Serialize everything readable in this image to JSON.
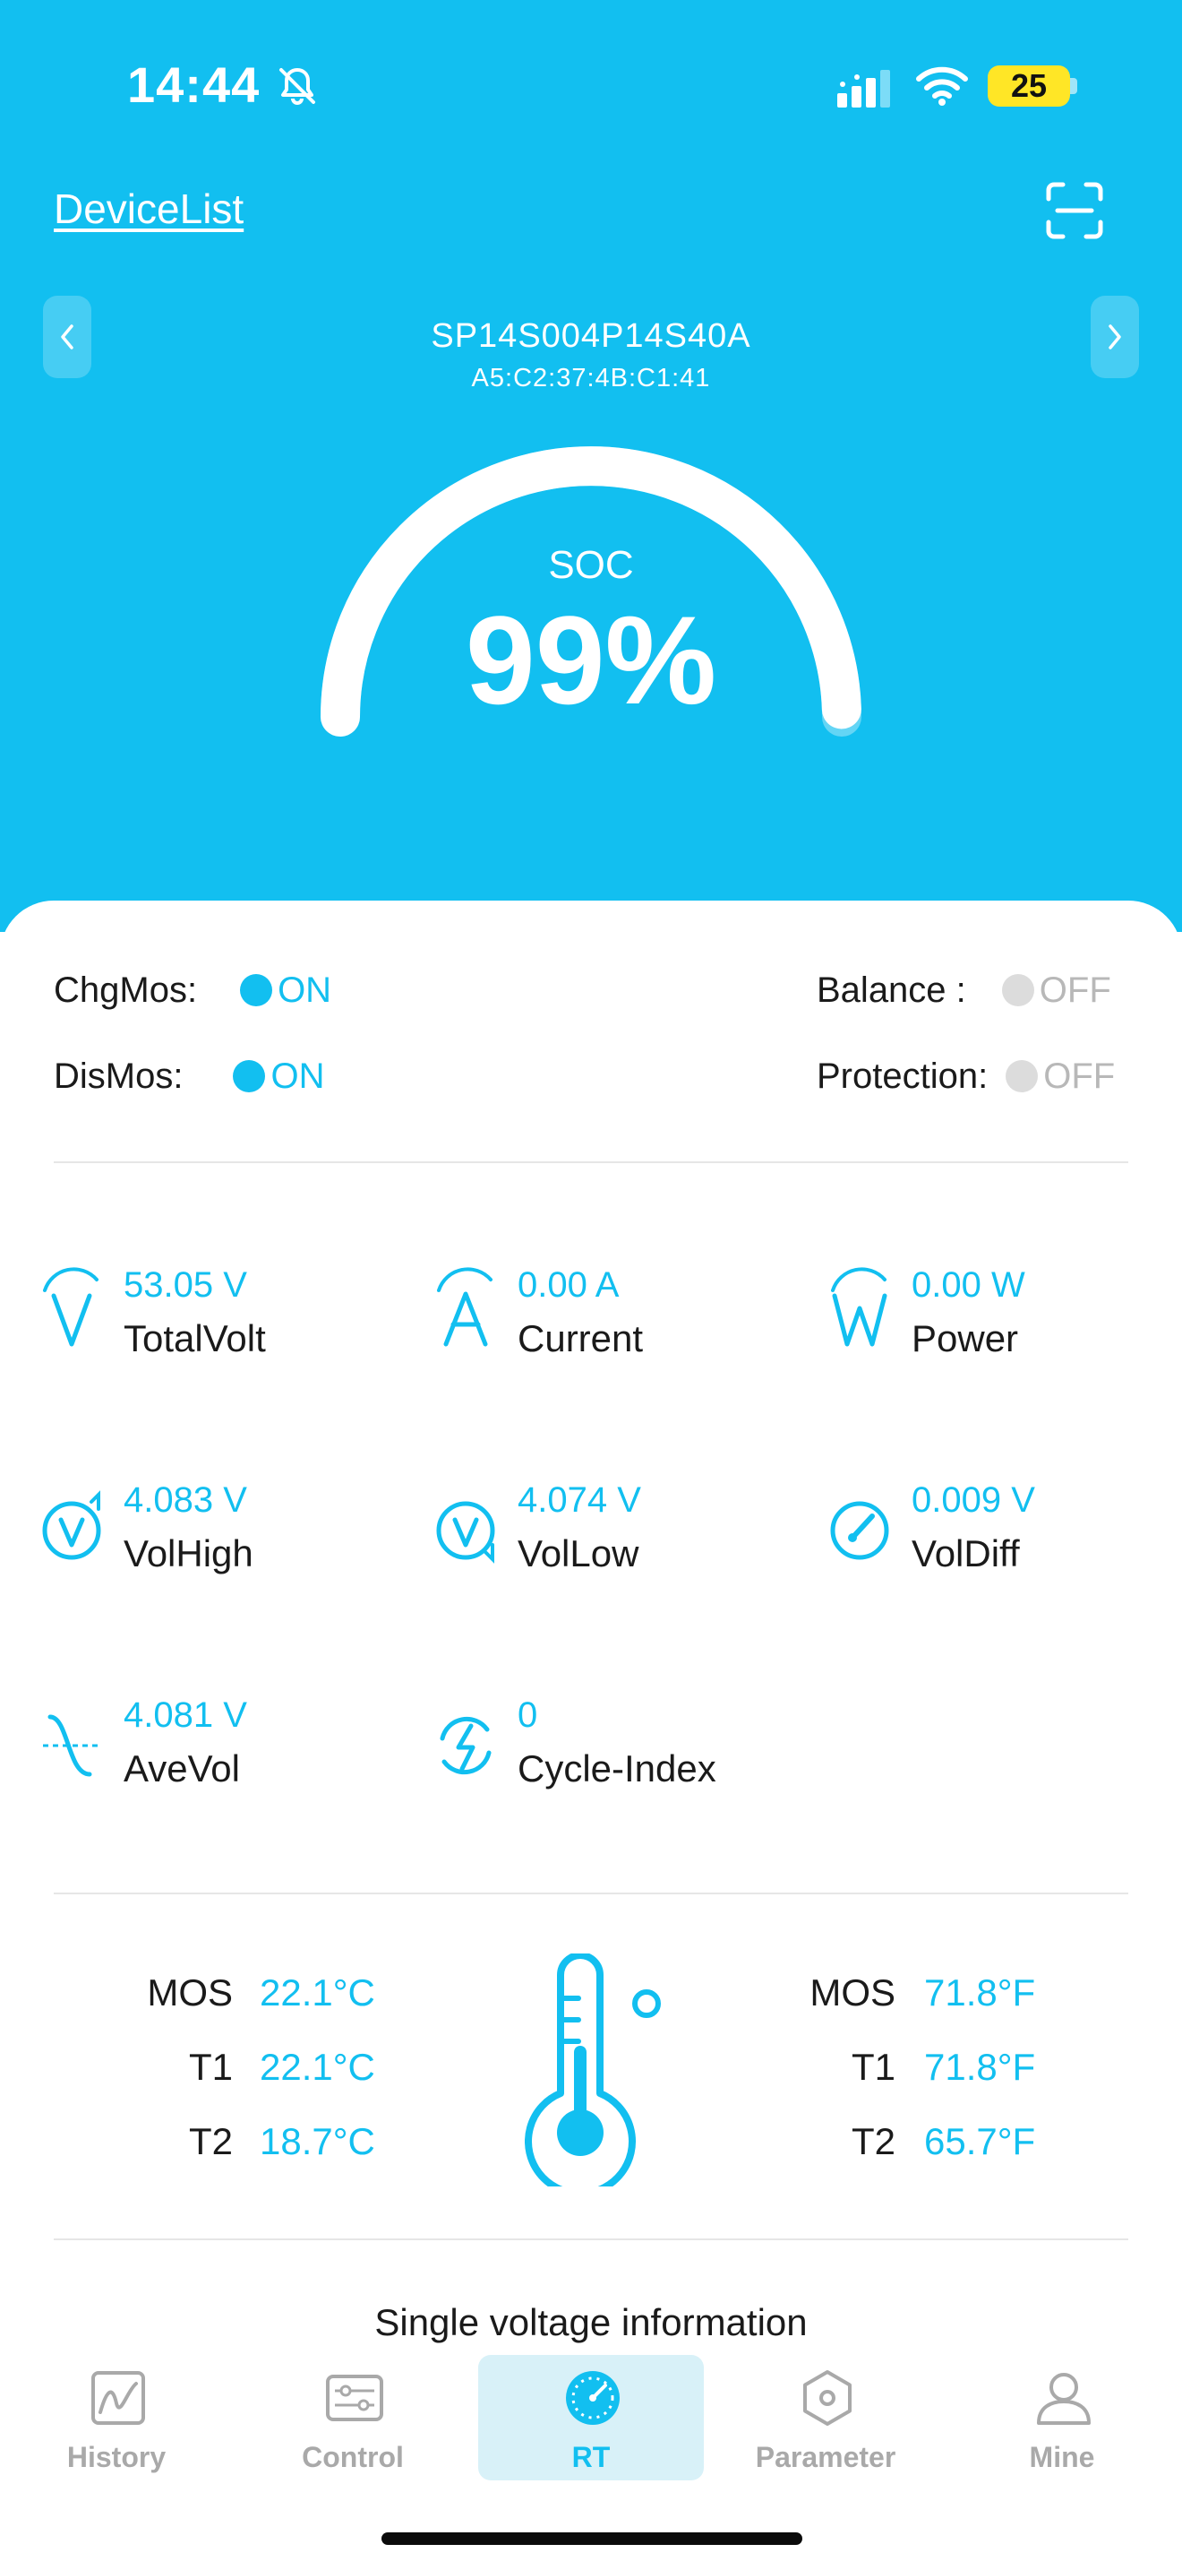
{
  "status_bar": {
    "time": "14:44",
    "battery": "25",
    "icons": [
      "bell-slash-icon",
      "cellular-signal-icon",
      "wifi-icon",
      "battery-icon"
    ]
  },
  "header": {
    "device_list_link": "DeviceList",
    "scan_icon": "scan-icon"
  },
  "device": {
    "name": "SP14S004P14S40A",
    "mac": "A5:C2:37:4B:C1:41",
    "prev_icon": "chevron-left-icon",
    "next_icon": "chevron-right-icon"
  },
  "soc": {
    "label": "SOC",
    "value": "99%",
    "percent": 99
  },
  "switches": {
    "chgmos": {
      "label": "ChgMos:",
      "state": "ON"
    },
    "dismos": {
      "label": "DisMos:",
      "state": "ON"
    },
    "balance": {
      "label": "Balance :",
      "state": "OFF"
    },
    "protection": {
      "label": "Protection:",
      "state": "OFF"
    }
  },
  "metrics": [
    {
      "value": "53.05 V",
      "name": "TotalVolt",
      "icon": "voltage-icon"
    },
    {
      "value": "0.00 A",
      "name": "Current",
      "icon": "current-icon"
    },
    {
      "value": "0.00 W",
      "name": "Power",
      "icon": "power-icon"
    },
    {
      "value": "4.083 V",
      "name": "VolHigh",
      "icon": "voltage-high-icon"
    },
    {
      "value": "4.074 V",
      "name": "VolLow",
      "icon": "voltage-low-icon"
    },
    {
      "value": "0.009 V",
      "name": "VolDiff",
      "icon": "gauge-icon"
    },
    {
      "value": "4.081 V",
      "name": "AveVol",
      "icon": "average-wave-icon"
    },
    {
      "value": "0",
      "name": "Cycle-Index",
      "icon": "cycle-bolt-icon"
    }
  ],
  "temperatures": {
    "celsius": [
      {
        "label": "MOS",
        "value": "22.1°C"
      },
      {
        "label": "T1",
        "value": "22.1°C"
      },
      {
        "label": "T2",
        "value": "18.7°C"
      }
    ],
    "fahrenheit": [
      {
        "label": "MOS",
        "value": "71.8°F"
      },
      {
        "label": "T1",
        "value": "71.8°F"
      },
      {
        "label": "T2",
        "value": "65.7°F"
      }
    ],
    "icon": "thermometer-icon"
  },
  "section": {
    "single_voltage_title": "Single voltage information"
  },
  "tabs": [
    {
      "label": "History",
      "icon": "history-chart-icon",
      "active": false
    },
    {
      "label": "Control",
      "icon": "control-sliders-icon",
      "active": false
    },
    {
      "label": "RT",
      "icon": "realtime-gauge-icon",
      "active": true
    },
    {
      "label": "Parameter",
      "icon": "parameter-hexagon-icon",
      "active": false
    },
    {
      "label": "Mine",
      "icon": "user-icon",
      "active": false
    }
  ],
  "colors": {
    "accent": "#12bff0",
    "off_gray": "#dcdcdc",
    "battery_yellow": "#ffe626",
    "text_dark": "#1a1a1a"
  }
}
